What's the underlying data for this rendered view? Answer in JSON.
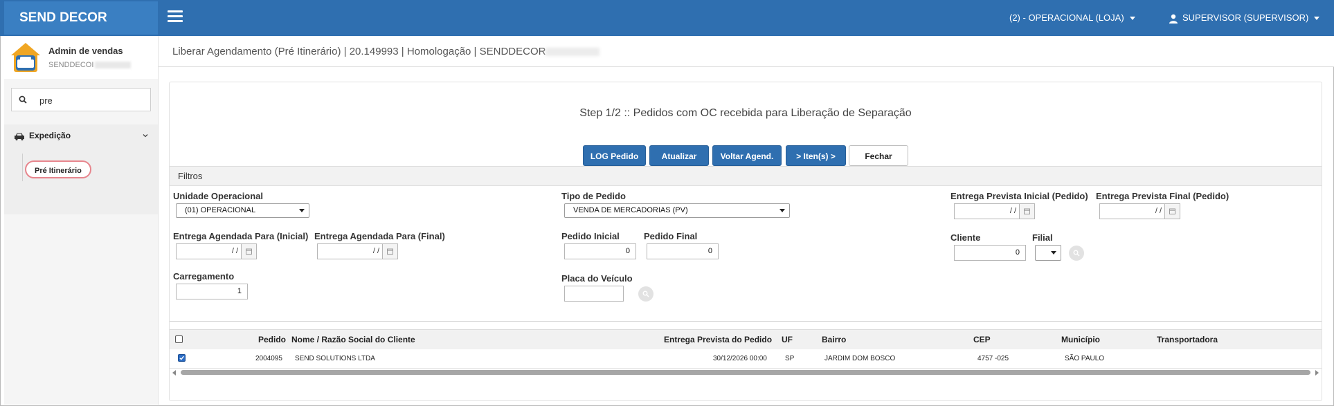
{
  "brand": "SEND DECOR",
  "topbar": {
    "unit_menu": "(2) - OPERACIONAL (LOJA)",
    "user_menu": "SUPERVISOR (SUPERVISOR)"
  },
  "sidebar": {
    "profile_name": "Admin de vendas",
    "profile_sub": "SENDDECOI",
    "search_value": "pre",
    "section_label": "Expedição",
    "item_label": "Pré Itinerário"
  },
  "page": {
    "title": "Liberar Agendamento (Pré Itinerário) | 20.149993 | Homologação | SENDDECOR"
  },
  "step_title": "Step 1/2 :: Pedidos com OC recebida para Liberação de Separação",
  "buttons": {
    "log_pedido": "LOG Pedido",
    "atualizar": "Atualizar",
    "voltar_agend": "Voltar Agend.",
    "itens": "> Iten(s) >",
    "fechar": "Fechar"
  },
  "filters": {
    "heading": "Filtros",
    "unidade_label": "Unidade Operacional",
    "unidade_value": "(01) OPERACIONAL",
    "tipo_label": "Tipo de Pedido",
    "tipo_value": "VENDA DE MERCADORIAS (PV)",
    "entrega_prev_ini_label": "Entrega Prevista Inicial (Pedido)",
    "entrega_prev_ini_value": "/ /",
    "entrega_prev_fim_label": "Entrega Prevista Final (Pedido)",
    "entrega_prev_fim_value": "/ /",
    "agendada_ini_label": "Entrega Agendada Para (Inicial)",
    "agendada_ini_value": "/ /",
    "agendada_fim_label": "Entrega Agendada Para (Final)",
    "agendada_fim_value": "/ /",
    "pedido_ini_label": "Pedido Inicial",
    "pedido_ini_value": "0",
    "pedido_fim_label": "Pedido Final",
    "pedido_fim_value": "0",
    "cliente_label": "Cliente",
    "cliente_value": "0",
    "filial_label": "Filial",
    "carregamento_label": "Carregamento",
    "carregamento_value": "1",
    "placa_label": "Placa do Veículo",
    "placa_value": ""
  },
  "table": {
    "headers": {
      "pedido": "Pedido",
      "cliente": "Nome / Razão Social do Cliente",
      "entrega": "Entrega Prevista do Pedido",
      "uf": "UF",
      "bairro": "Bairro",
      "cep": "CEP",
      "municipio": "Município",
      "transportadora": "Transportadora"
    },
    "rows": [
      {
        "checked": true,
        "pedido": "2004095",
        "cliente": "SEND SOLUTIONS LTDA",
        "entrega": "30/12/2026 00:00",
        "uf": "SP",
        "bairro": "JARDIM DOM BOSCO",
        "cep": "4757 -025",
        "municipio": "SÃO PAULO",
        "transportadora": ""
      }
    ]
  },
  "colors": {
    "primary": "#2f6fb0",
    "brand_bg": "#3a7fc2",
    "active_item_border": "#e7858d"
  }
}
